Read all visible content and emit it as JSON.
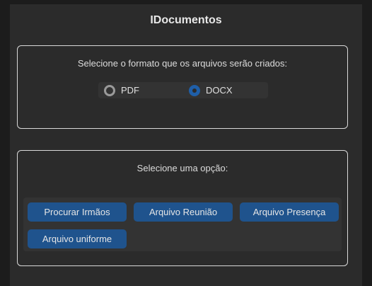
{
  "window": {
    "title": "IDocumentos"
  },
  "format_section": {
    "prompt": "Selecione o formato que os arquivos serão criados:",
    "options": [
      {
        "label": "PDF",
        "selected": false
      },
      {
        "label": "DOCX",
        "selected": true
      }
    ]
  },
  "options_section": {
    "prompt": "Selecione uma opção:",
    "buttons": [
      {
        "label": "Procurar Irmãos"
      },
      {
        "label": "Arquivo Reunião"
      },
      {
        "label": "Arquivo Presença"
      },
      {
        "label": "Arquivo uniforme"
      }
    ]
  },
  "colors": {
    "background": "#2b2b2b",
    "accent": "#1f538d",
    "radio_selected": "#1f5fa8"
  }
}
